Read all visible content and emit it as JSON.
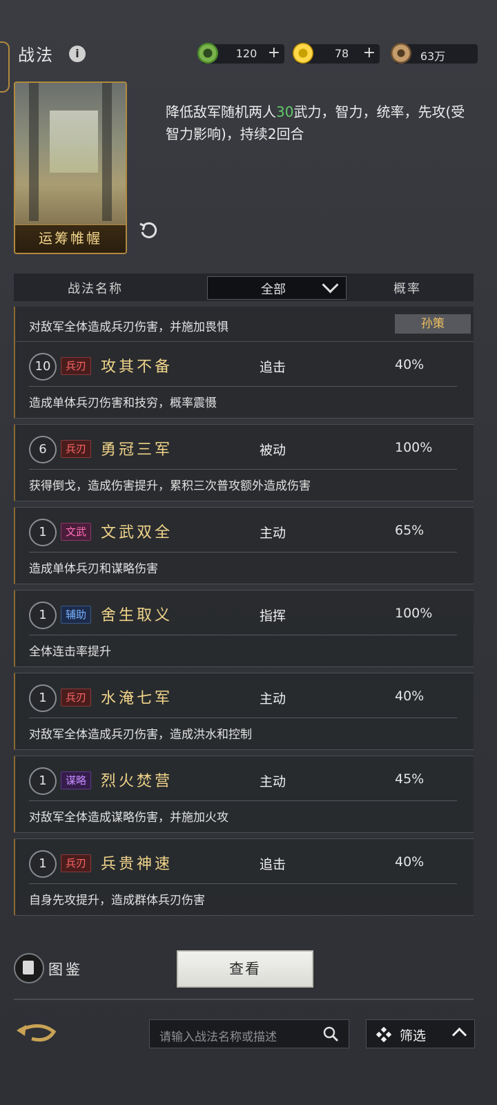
{
  "header": {
    "title": "战法",
    "currencies": [
      {
        "icon": "jade-coin-icon",
        "value": "120",
        "has_plus": true
      },
      {
        "icon": "gold-ingot-icon",
        "value": "78",
        "has_plus": true
      },
      {
        "icon": "copper-coin-icon",
        "value": "63万",
        "has_plus": false
      }
    ]
  },
  "selected": {
    "card_name": "运筹帷幄",
    "description_prefix": "降低敌军随机两人",
    "description_value": "30",
    "description_suffix": "武力，智力，统率，先攻(受智力影响)，持续2回合"
  },
  "table_header": {
    "name_col": "战法名称",
    "filter_value": "全部",
    "rate_col": "概率"
  },
  "partial_row": {
    "desc": "对敌军全体造成兵刃伤害，并施加畏惧",
    "owner": "孙策"
  },
  "skills": [
    {
      "level": "10",
      "tag": "兵刃",
      "tag_kind": "bing",
      "name": "攻其不备",
      "type": "追击",
      "rate": "40%",
      "desc": "造成单体兵刃伤害和技穷，概率震慑"
    },
    {
      "level": "6",
      "tag": "兵刃",
      "tag_kind": "bing",
      "name": "勇冠三军",
      "type": "被动",
      "rate": "100%",
      "desc": "获得倒戈，造成伤害提升，累积三次普攻额外造成伤害"
    },
    {
      "level": "1",
      "tag": "文武",
      "tag_kind": "wen",
      "name": "文武双全",
      "type": "主动",
      "rate": "65%",
      "desc": "造成单体兵刃和谋略伤害"
    },
    {
      "level": "1",
      "tag": "辅助",
      "tag_kind": "fu",
      "name": "舍生取义",
      "type": "指挥",
      "rate": "100%",
      "desc": "全体连击率提升"
    },
    {
      "level": "1",
      "tag": "兵刃",
      "tag_kind": "bing",
      "name": "水淹七军",
      "type": "主动",
      "rate": "40%",
      "desc": "对敌军全体造成兵刃伤害，造成洪水和控制"
    },
    {
      "level": "1",
      "tag": "谋略",
      "tag_kind": "mou",
      "name": "烈火焚营",
      "type": "主动",
      "rate": "45%",
      "desc": "对敌军全体造成谋略伤害，并施加火攻"
    },
    {
      "level": "1",
      "tag": "兵刃",
      "tag_kind": "bing",
      "name": "兵贵神速",
      "type": "追击",
      "rate": "40%",
      "desc": "自身先攻提升，造成群体兵刃伤害"
    }
  ],
  "bottom": {
    "codex_label": "图鉴",
    "view_button": "查看",
    "search_placeholder": "请输入战法名称或描述",
    "filter_label": "筛选"
  }
}
